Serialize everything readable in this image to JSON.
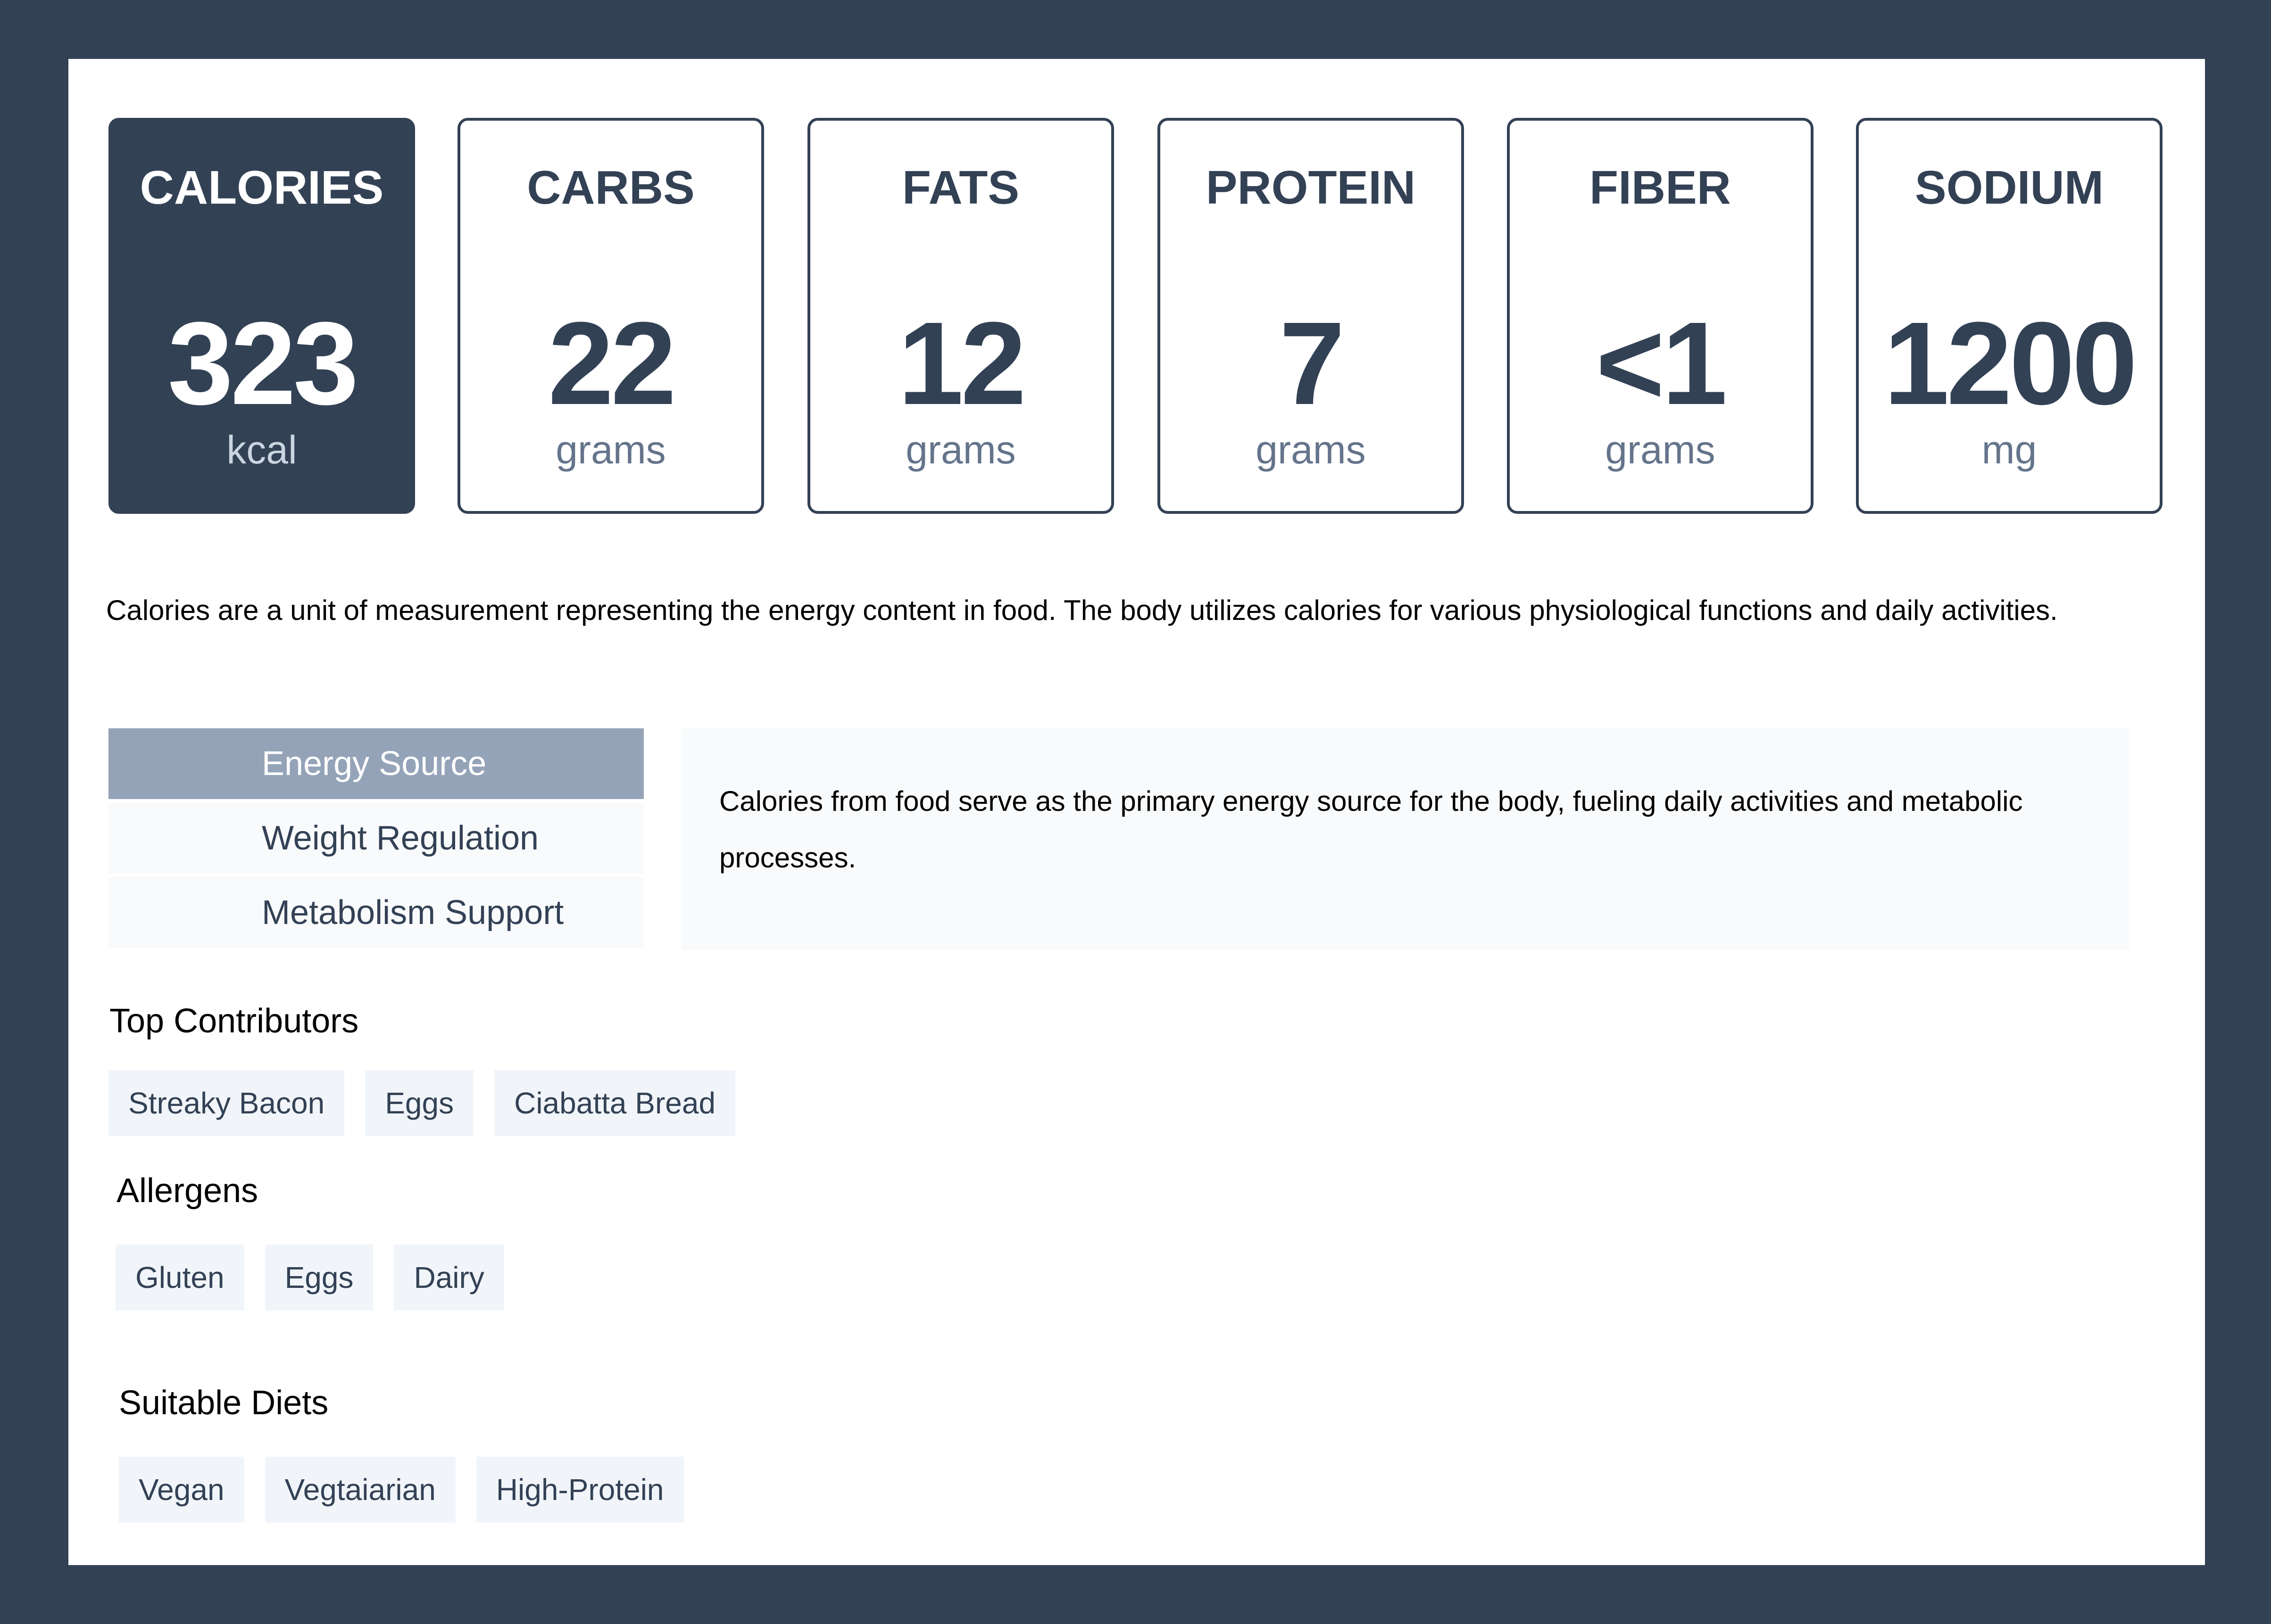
{
  "nutrients": [
    {
      "label": "CALORIES",
      "value": "323",
      "unit": "kcal",
      "active": true
    },
    {
      "label": "CARBS",
      "value": "22",
      "unit": "grams",
      "active": false
    },
    {
      "label": "FATS",
      "value": "12",
      "unit": "grams",
      "active": false
    },
    {
      "label": "PROTEIN",
      "value": "7",
      "unit": "grams",
      "active": false
    },
    {
      "label": "FIBER",
      "value": "<1",
      "unit": "grams",
      "active": false
    },
    {
      "label": "SODIUM",
      "value": "1200",
      "unit": "mg",
      "active": false
    }
  ],
  "intro": "Calories are a unit of measurement representing the energy content in food. The body utilizes calories for various physiological functions and daily activities.",
  "tabs": [
    {
      "label": "Energy Source",
      "active": true
    },
    {
      "label": "Weight Regulation",
      "active": false
    },
    {
      "label": "Metabolism Support",
      "active": false
    }
  ],
  "tab_content": "Calories from food serve as the primary energy source for the body, fueling daily activities and metabolic processes.",
  "top_contributors": {
    "title": "Top Contributors",
    "items": [
      "Streaky Bacon",
      "Eggs",
      "Ciabatta Bread"
    ]
  },
  "allergens": {
    "title": "Allergens",
    "items": [
      "Gluten",
      "Eggs",
      "Dairy"
    ]
  },
  "suitable_diets": {
    "title": "Suitable Diets",
    "items": [
      "Vegan",
      "Vegtaiarian",
      "High-Protein"
    ]
  },
  "colors": {
    "primary": "#334155",
    "tab_active": "#94a3b8",
    "tag_bg": "#f1f5f9",
    "muted": "#64748b"
  }
}
